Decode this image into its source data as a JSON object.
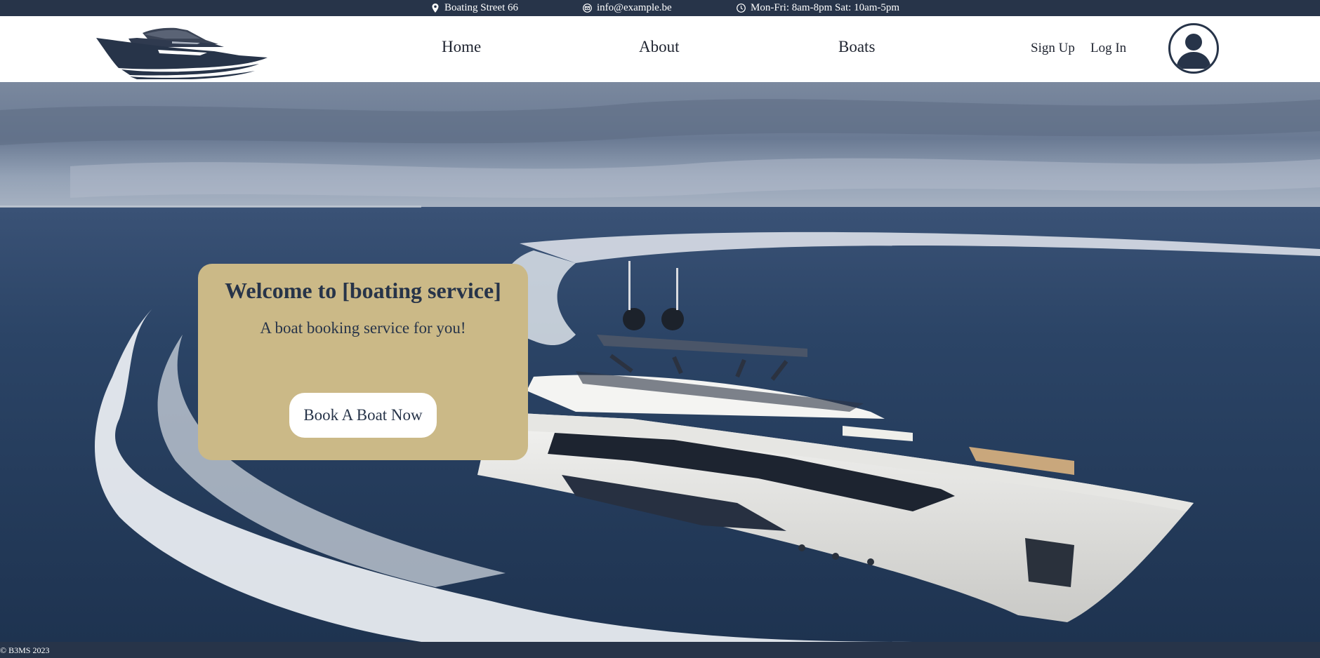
{
  "topbar": {
    "address": "Boating Street 66",
    "email": "info@example.be",
    "hours": "Mon-Fri: 8am-8pm Sat: 10am-5pm",
    "address_icon": "map-pin-icon",
    "email_icon": "envelope-icon",
    "hours_icon": "clock-icon"
  },
  "header": {
    "logo_icon": "yacht-logo-icon",
    "nav": {
      "home": "Home",
      "about": "About",
      "boats": "Boats"
    },
    "signup": "Sign Up",
    "login": "Log In",
    "avatar_icon": "user-avatar-icon"
  },
  "hero": {
    "title": "Welcome to [boating service]",
    "subtitle": "A boat booking service for you!",
    "cta": "Book A Boat Now"
  },
  "footer": {
    "copyright": "© B3MS 2023"
  },
  "colors": {
    "navy": "#273449",
    "gold": "#cbb987",
    "white": "#ffffff"
  }
}
